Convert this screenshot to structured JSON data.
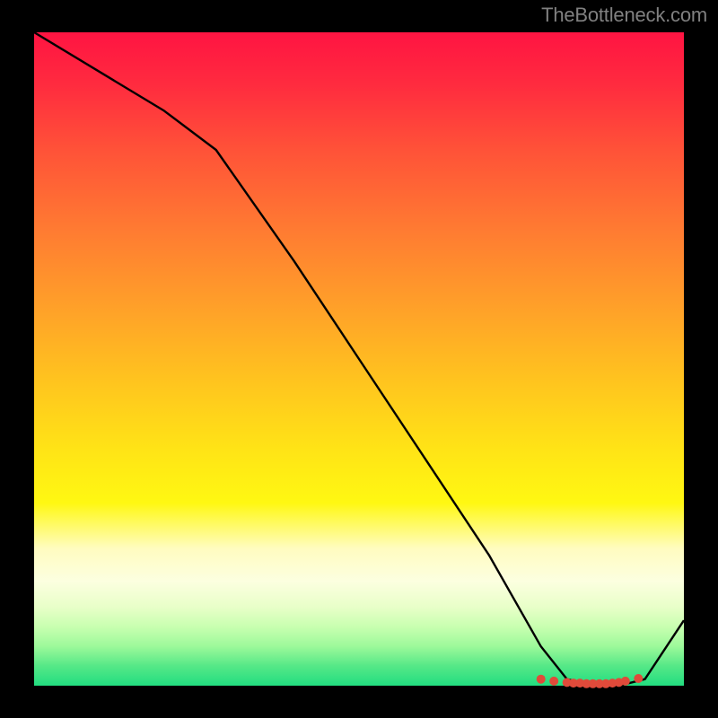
{
  "attribution": "TheBottleneck.com",
  "colors": {
    "top": "#ff1442",
    "mid": "#ffe416",
    "bottom": "#22dd80",
    "line": "#000000",
    "marker": "#e04a3a"
  },
  "chart_data": {
    "type": "line",
    "title": "",
    "xlabel": "",
    "ylabel": "",
    "xlim": [
      0,
      100
    ],
    "ylim": [
      0,
      100
    ],
    "x": [
      0,
      10,
      20,
      28,
      40,
      50,
      60,
      70,
      78,
      82,
      86,
      90,
      94,
      100
    ],
    "values": [
      100,
      94,
      88,
      82,
      65,
      50,
      35,
      20,
      6,
      1,
      0,
      0,
      1,
      10
    ],
    "markers_x": [
      78,
      80,
      82,
      83,
      84,
      85,
      86,
      87,
      88,
      89,
      90,
      91,
      93
    ],
    "markers_y": [
      1.0,
      0.7,
      0.5,
      0.4,
      0.4,
      0.3,
      0.3,
      0.3,
      0.3,
      0.4,
      0.5,
      0.7,
      1.1
    ],
    "note": "Axis values are normalized 0–100; the screenshot has no visible tick labels."
  }
}
